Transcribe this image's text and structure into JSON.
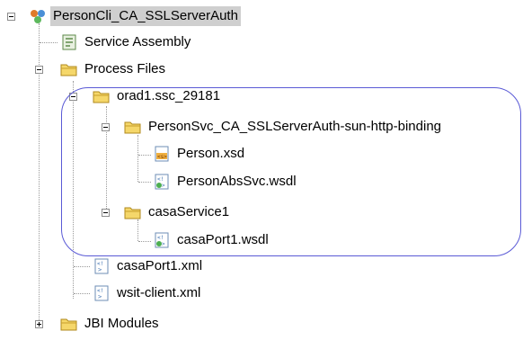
{
  "tree": {
    "root": {
      "label": "PersonCli_CA_SSLServerAuth",
      "icon": "composite-app-icon"
    },
    "service_assembly": {
      "label": "Service Assembly",
      "icon": "service-assembly-icon"
    },
    "process_files": {
      "label": "Process Files",
      "icon": "folder-icon"
    },
    "orad1": {
      "label": "orad1.ssc_29181",
      "icon": "folder-icon"
    },
    "person_svc": {
      "label": "PersonSvc_CA_SSLServerAuth-sun-http-binding",
      "icon": "folder-icon"
    },
    "person_xsd": {
      "label": "Person.xsd",
      "icon": "xsd-file-icon"
    },
    "person_abs_wsdl": {
      "label": "PersonAbsSvc.wsdl",
      "icon": "wsdl-file-icon"
    },
    "casa_service": {
      "label": "casaService1",
      "icon": "folder-icon"
    },
    "casa_port_wsdl": {
      "label": "casaPort1.wsdl",
      "icon": "wsdl-file-icon"
    },
    "casa_port_xml": {
      "label": "casaPort1.xml",
      "icon": "xml-file-icon"
    },
    "wsit_client": {
      "label": "wsit-client.xml",
      "icon": "xml-file-icon"
    },
    "jbi_modules": {
      "label": "JBI Modules",
      "icon": "folder-icon"
    }
  },
  "colors": {
    "highlight_border": "#5a5ad6",
    "selection_bg": "#cfcfcf",
    "folder_fill": "#f5d76a",
    "folder_border": "#b08a1e"
  }
}
